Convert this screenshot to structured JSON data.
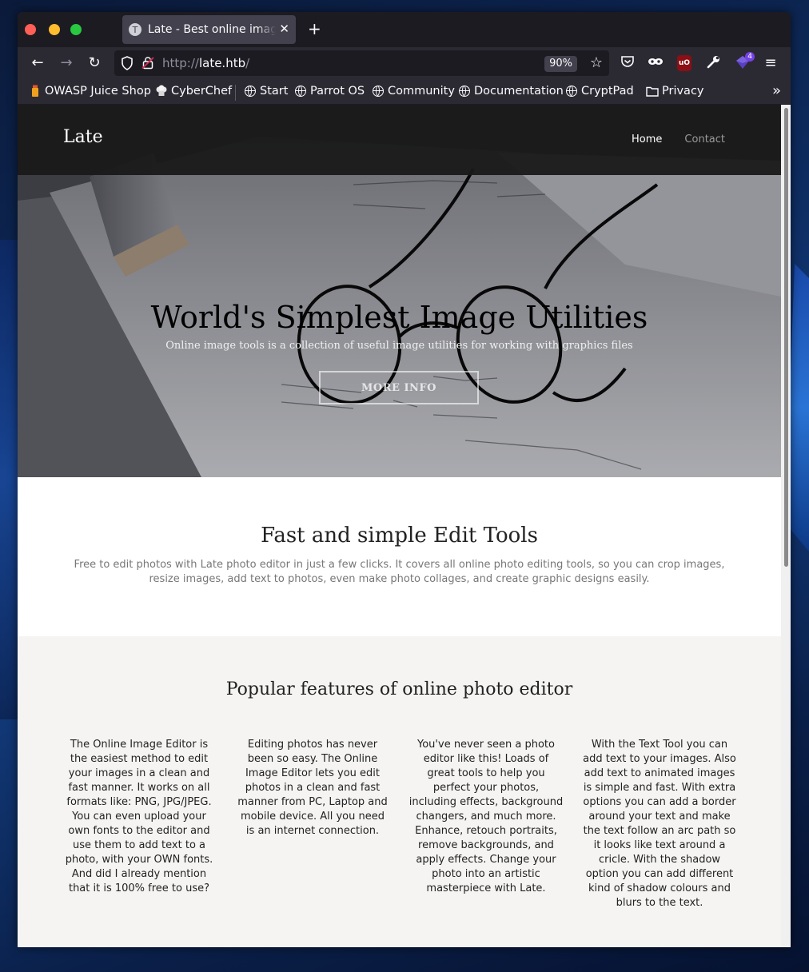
{
  "browser": {
    "tab_title": "Late - Best online image t",
    "tab_favicon_letter": "T",
    "url_scheme": "http://",
    "url_host": "late.htb",
    "url_path": "/",
    "zoom": "90%",
    "extension_badge": "4",
    "ublock_label": "uO"
  },
  "bookmarks": [
    {
      "label": "OWASP Juice Shop",
      "icon": "juice-icon"
    },
    {
      "label": "CyberChef",
      "icon": "chef-icon"
    },
    {
      "label": "Start",
      "icon": "globe-icon"
    },
    {
      "label": "Parrot OS",
      "icon": "globe-icon"
    },
    {
      "label": "Community",
      "icon": "globe-icon"
    },
    {
      "label": "Documentation",
      "icon": "globe-icon"
    },
    {
      "label": "CryptPad",
      "icon": "globe-icon"
    },
    {
      "label": "Privacy",
      "icon": "folder-icon"
    }
  ],
  "site": {
    "logo": "Late",
    "nav": {
      "home": "Home",
      "contact": "Contact"
    },
    "hero": {
      "title": "World's Simplest Image Utilities",
      "subtitle": "Online image tools is a collection of useful image utilities for working with graphics files",
      "button": "MORE INFO"
    },
    "tools": {
      "title": "Fast and simple Edit Tools",
      "description": "Free to edit photos with Late photo editor in just a few clicks. It covers all online photo editing tools, so you can crop images, resize images, add text to photos, even make photo collages, and create graphic designs easily."
    },
    "features": {
      "title": "Popular features of online photo editor",
      "columns": [
        "The Online Image Editor is the easiest method to edit your images in a clean and fast manner. It works on all formats like: PNG, JPG/JPEG. You can even upload your own fonts to the editor and use them to add text to a photo, with your OWN fonts. And did I already mention that it is 100% free to use?",
        "Editing photos has never been so easy. The Online Image Editor lets you edit photos in a clean and fast manner from PC, Laptop and mobile device. All you need is an internet connection.",
        "You've never seen a photo editor like this! Loads of great tools to help you perfect your photos, including effects, background changers, and much more. Enhance, retouch portraits, remove backgrounds, and apply effects. Change your photo into an artistic masterpiece with Late.",
        "With the Text Tool you can add text to your images. Also add text to animated images is simple and fast. With extra options you can add a border around your text and make the text follow an arc path so it looks like text around a cricle. With the shadow option you can add different kind of shadow colours and blurs to the text."
      ]
    }
  },
  "colors": {
    "browser_chrome": "#2b2a33",
    "tabstrip": "#1c1b22",
    "header_bg": "#191919",
    "features_bg": "#f5f4f2"
  }
}
